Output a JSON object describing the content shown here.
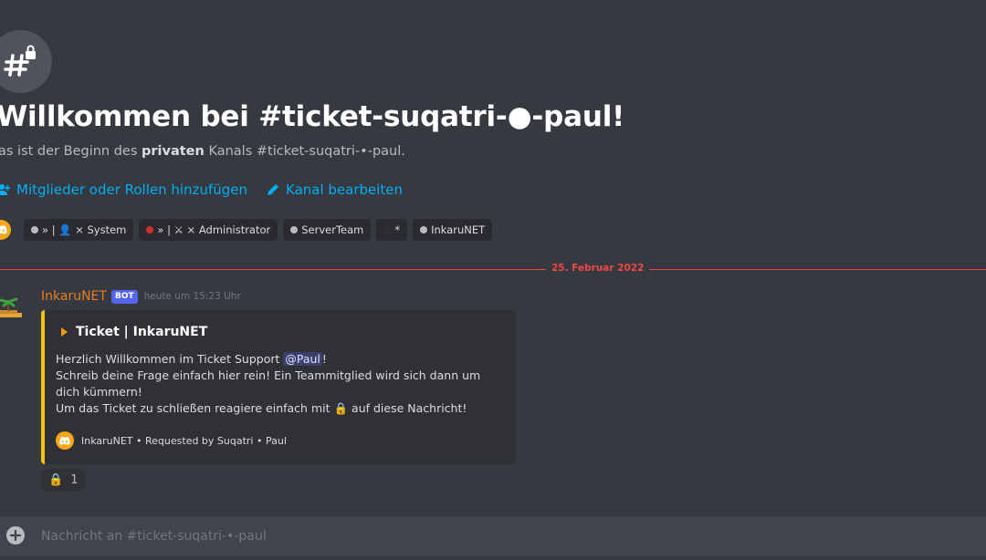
{
  "welcome": {
    "title": "Willkommen bei #ticket-suqatri-●-paul!",
    "subtitle_prefix": "as ist der Beginn des ",
    "subtitle_bold": "privaten",
    "subtitle_suffix": " Kanals #ticket-suqatri-•-paul."
  },
  "actions": {
    "add_members": "Mitglieder oder Rollen hinzufügen",
    "edit_channel": "Kanal bearbeiten"
  },
  "roles": [
    {
      "dot_color": "#b9bbbe",
      "label": "» | 👤 × System"
    },
    {
      "dot_color": "#d32f2f",
      "label": "» | ⚔ × Administrator"
    },
    {
      "dot_color": "#b9bbbe",
      "label": "ServerTeam"
    },
    {
      "dot_color": "#2f3136",
      "label": "*"
    },
    {
      "dot_color": "#b9bbbe",
      "label": "InkaruNET"
    }
  ],
  "divider": {
    "date": "25. Februar 2022"
  },
  "message": {
    "author": "InkaruNET",
    "bot_tag": "BOT",
    "timestamp": "heute um 15:23 Uhr",
    "embed": {
      "title": "Ticket | InkaruNET",
      "line1_prefix": "Herzlich Willkommen im Ticket Support ",
      "mention": "@Paul",
      "line1_suffix": "!",
      "line2": "Schreib deine Frage einfach hier rein! Ein Teammitglied wird sich dann um dich kümmern!",
      "line3_prefix": "Um das Ticket zu schließen reagiere einfach mit ",
      "line3_emoji": "🔒",
      "line3_suffix": " auf diese Nachricht!",
      "footer": "InkaruNET • Requested by Suqatri • Paul",
      "accent_color": "#f1c40f"
    },
    "reaction": {
      "emoji": "🔒",
      "count": "1"
    }
  },
  "composer": {
    "placeholder": "Nachricht an #ticket-suqatri-•-paul"
  },
  "colors": {
    "link": "#00aff4",
    "author": "#e67e22",
    "divider": "#f04747",
    "bot_tag": "#5865f2"
  }
}
